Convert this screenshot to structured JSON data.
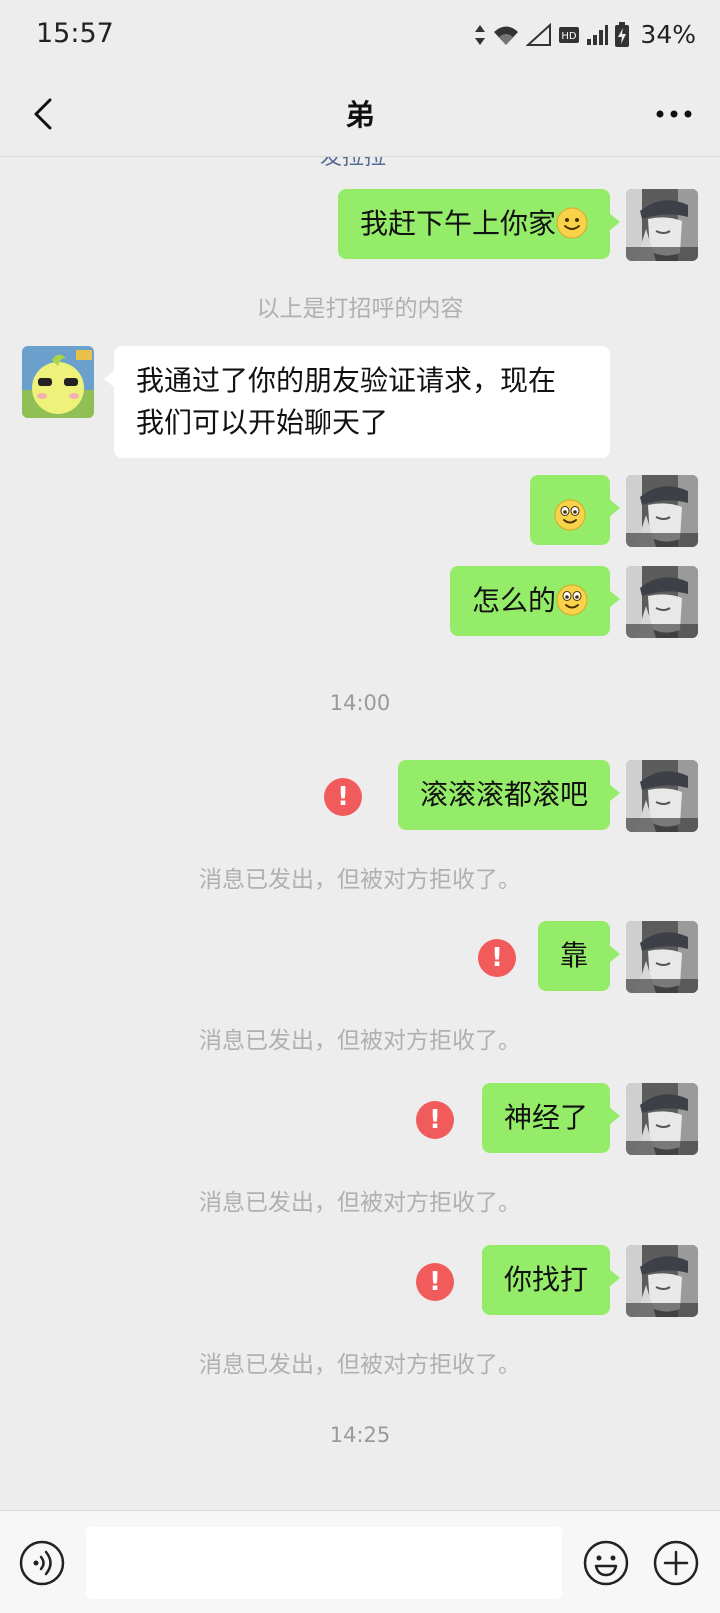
{
  "status_bar": {
    "time": "15:57",
    "battery_percent": "34%",
    "icons": [
      "data-arrows-icon",
      "wifi-icon",
      "signal-icon",
      "hd-icon",
      "signal-bars-icon",
      "battery-charging-icon"
    ]
  },
  "header": {
    "title": "弟",
    "back_icon": "back-arrow-icon",
    "more_icon": "more-icon"
  },
  "chat": {
    "cut_text": "发拉拉",
    "messages": [
      {
        "from": "me",
        "text": "我赶下午上你家",
        "emoji": "smile-emoji"
      },
      {
        "type": "system",
        "text": "以上是打招呼的内容"
      },
      {
        "from": "other",
        "lines": [
          "我通过了你的朋友验证请求，现在",
          "我们可以开始聊天了"
        ]
      },
      {
        "from": "me",
        "text": "",
        "emoji": "grin-emoji"
      },
      {
        "from": "me",
        "text": "怎么的",
        "emoji": "grin-emoji"
      },
      {
        "type": "time",
        "text": "14:00"
      },
      {
        "from": "me",
        "text": "滚滚滚都滚吧",
        "failed": true
      },
      {
        "type": "system",
        "text": "消息已发出，但被对方拒收了。"
      },
      {
        "from": "me",
        "text": "靠",
        "failed": true
      },
      {
        "type": "system",
        "text": "消息已发出，但被对方拒收了。"
      },
      {
        "from": "me",
        "text": "神经了",
        "failed": true
      },
      {
        "type": "system",
        "text": "消息已发出，但被对方拒收了。"
      },
      {
        "from": "me",
        "text": "你找打",
        "failed": true
      },
      {
        "type": "system",
        "text": "消息已发出，但被对方拒收了。"
      },
      {
        "type": "time",
        "text": "14:25"
      }
    ],
    "failed_icon_text": "!"
  },
  "input_bar": {
    "voice_icon": "voice-icon",
    "emoji_icon": "emoji-icon",
    "plus_icon": "plus-icon",
    "input_value": ""
  },
  "colors": {
    "background": "#ededed",
    "my_bubble": "#95ec69",
    "other_bubble": "#ffffff",
    "failed_badge": "#f25b5b",
    "system_text": "#b0b0b0"
  }
}
